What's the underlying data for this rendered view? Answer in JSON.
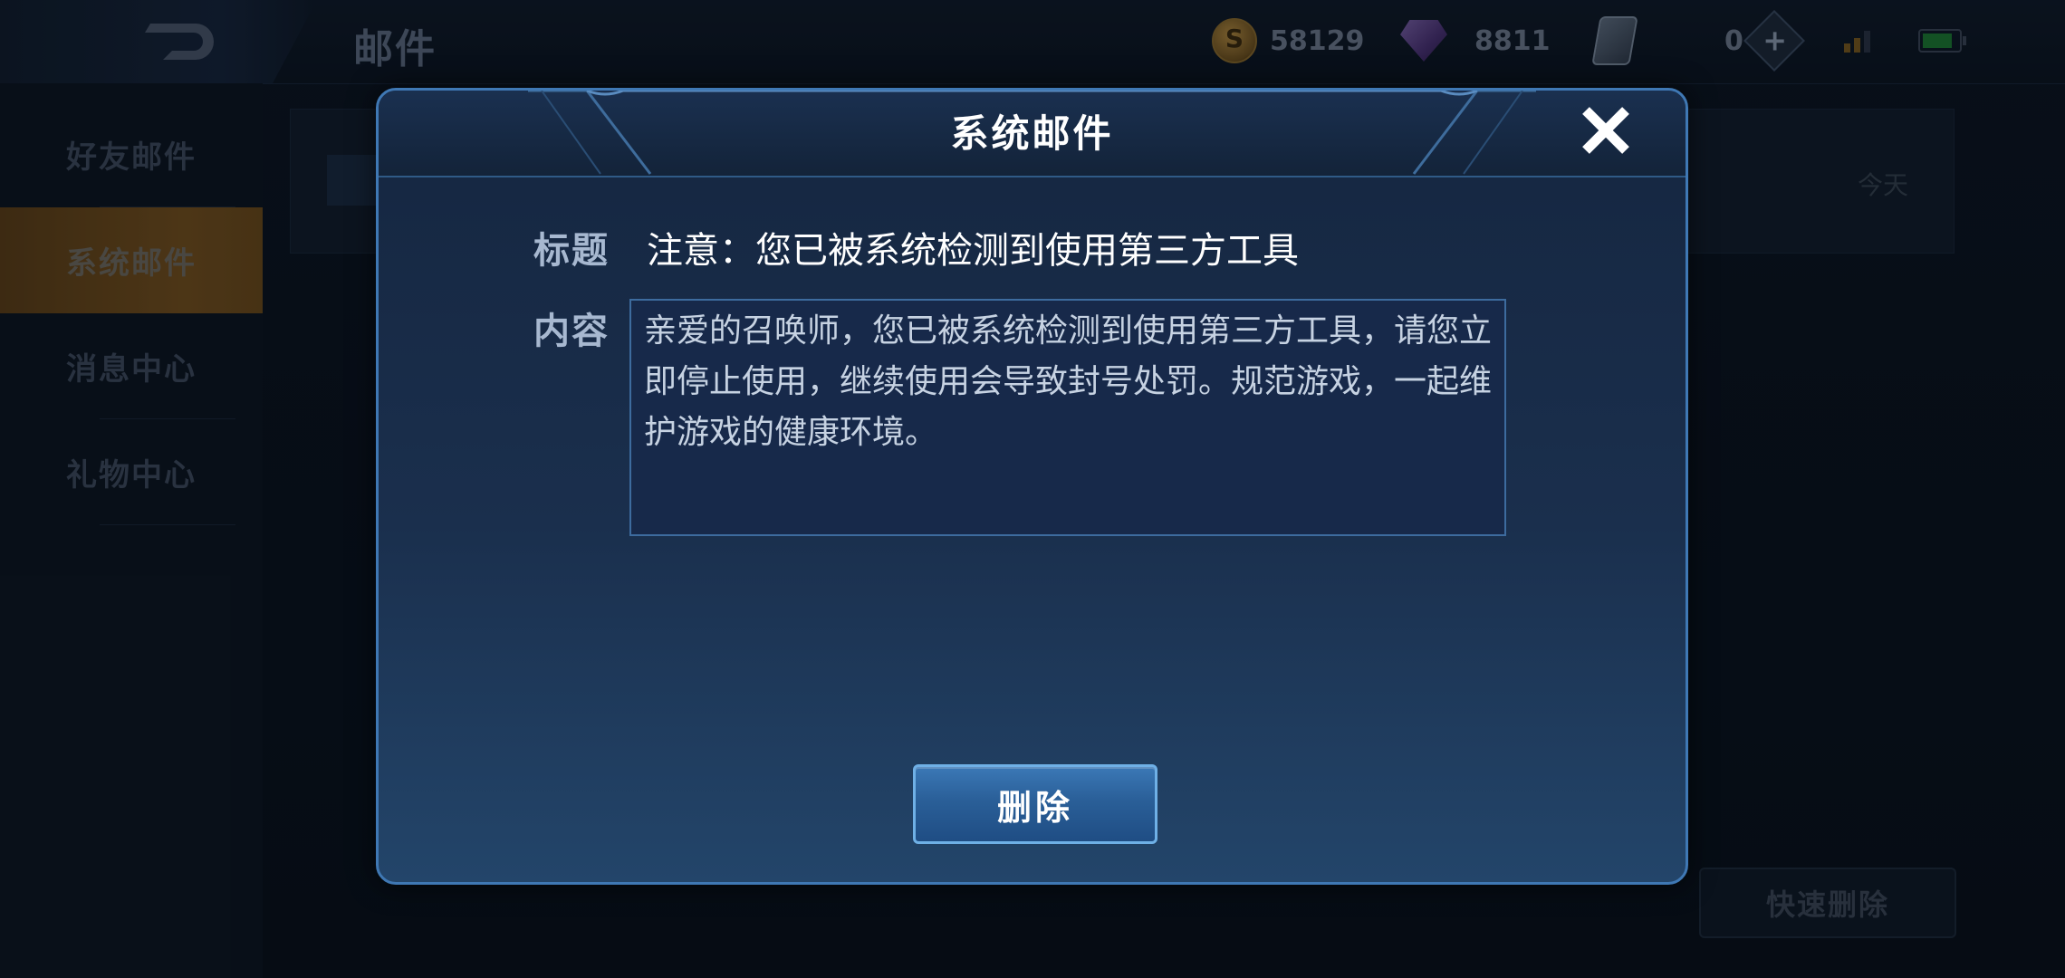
{
  "topbar": {
    "title": "邮件",
    "gold": "58129",
    "diamonds": "8811",
    "tickets": "0"
  },
  "sidebar": {
    "items": [
      {
        "label": "好友邮件"
      },
      {
        "label": "系统邮件"
      },
      {
        "label": "消息中心"
      },
      {
        "label": "礼物中心"
      }
    ]
  },
  "mail_list": {
    "date": "今天"
  },
  "quick_delete_label": "快速删除",
  "modal": {
    "title": "系统邮件",
    "subject_label": "标题",
    "subject": "注意：您已被系统检测到使用第三方工具",
    "content_label": "内容",
    "content": "亲爱的召唤师，您已被系统检测到使用第三方工具，请您立即停止使用，继续使用会导致封号处罚。规范游戏，一起维护游戏的健康环境。",
    "delete_label": "删除"
  },
  "colors": {
    "accent": "#3f78b4",
    "active_tab": "#74501d"
  }
}
